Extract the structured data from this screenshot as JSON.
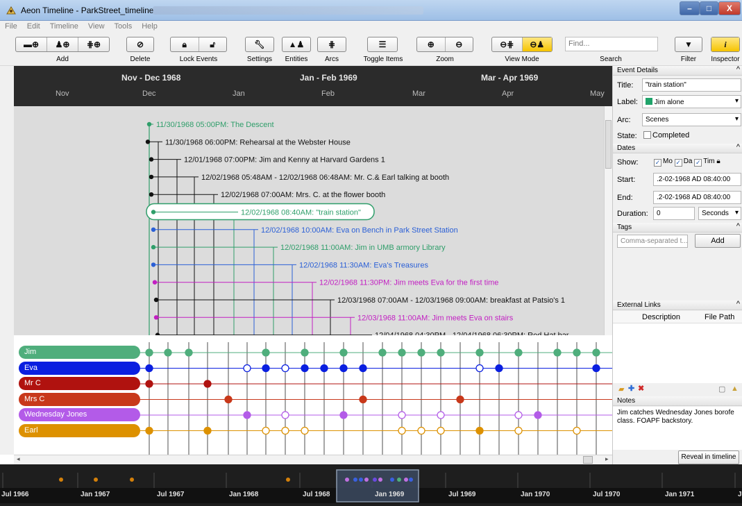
{
  "window": {
    "title": "Aeon Timeline - ParkStreet_timeline",
    "min": "–",
    "max": "□",
    "close": "X"
  },
  "menu": [
    "File",
    "Edit",
    "Timeline",
    "View",
    "Tools",
    "Help"
  ],
  "toolbar": {
    "add_label": "Add",
    "delete_label": "Delete",
    "lock_label": "Lock Events",
    "settings_label": "Settings",
    "entities_label": "Entities",
    "arcs_label": "Arcs",
    "toggle_label": "Toggle Items",
    "zoom_label": "Zoom",
    "viewmode_label": "View Mode",
    "search_placeholder": "Find...",
    "search_label": "Search",
    "filter_label": "Filter",
    "inspector_label": "Inspector"
  },
  "header": {
    "periods": [
      "Nov - Dec 1968",
      "Jan - Feb 1969",
      "Mar - Apr 1969"
    ],
    "months": [
      "Nov",
      "Dec",
      "Jan",
      "Feb",
      "Mar",
      "Apr",
      "May"
    ]
  },
  "events": [
    {
      "text": "11/30/1968 05:00PM: The Descent",
      "color": "#2f9e6a"
    },
    {
      "text": "11/30/1968 06:00PM: Rehearsal at the Webster House",
      "color": "#111111"
    },
    {
      "text": "12/01/1968 07:00PM: Jim and Kenny at Harvard Gardens 1",
      "color": "#111111"
    },
    {
      "text": "12/02/1968 05:48AM - 12/02/1968 06:48AM: Mr. C.& Earl talking at booth",
      "color": "#111111"
    },
    {
      "text": "12/02/1968 07:00AM: Mrs. C. at the flower booth",
      "color": "#111111"
    },
    {
      "text": "12/02/1968 08:40AM: \"train station\"",
      "color": "#2f9e6a",
      "selected": true
    },
    {
      "text": "12/02/1968 10:00AM: Eva on Bench in Park Street Station",
      "color": "#2a5fd6"
    },
    {
      "text": "12/02/1968 11:00AM: Jim in UMB armory Library",
      "color": "#2f9e6a"
    },
    {
      "text": "12/02/1968 11:30AM: Eva's Treasures",
      "color": "#2a5fd6"
    },
    {
      "text": "12/02/1968 11:30PM: Jim meets Eva for the first time",
      "color": "#c21fc2"
    },
    {
      "text": "12/03/1968 07:00AM - 12/03/1968 09:00AM: breakfast at Patsio's 1",
      "color": "#111111"
    },
    {
      "text": "12/03/1968 11:00AM: Jim meets Eva on stairs",
      "color": "#c21fc2"
    },
    {
      "text": "12/04/1968 04:30PM - 12/04/1968 06:30PM: Red Hat bar",
      "color": "#111111"
    }
  ],
  "entities": [
    {
      "name": "Jim",
      "color": "#4fae7c"
    },
    {
      "name": "Eva",
      "color": "#0a1fe0"
    },
    {
      "name": "Mr C",
      "color": "#b0120f"
    },
    {
      "name": "Mrs C",
      "color": "#c8381a"
    },
    {
      "name": "Wednesday Jones",
      "color": "#b35be8"
    },
    {
      "name": "Earl",
      "color": "#dd9100"
    }
  ],
  "overview": {
    "labels": [
      "Jul 1966",
      "Jan 1967",
      "Jul 1967",
      "Jan 1968",
      "Jul 1968",
      "Jan 1969",
      "Jul 1969",
      "Jan 1970",
      "Jul 1970",
      "Jan 1971",
      "Jul"
    ]
  },
  "inspector": {
    "event_details": "Event Details",
    "title_label": "Title:",
    "title_value": "\"train station\"",
    "label_label": "Label:",
    "label_value": "Jim alone",
    "label_color": "#1fa36a",
    "arc_label": "Arc:",
    "arc_value": "Scenes",
    "state_label": "State:",
    "state_value": "Completed",
    "dates": "Dates",
    "show_label": "Show:",
    "show_mo": "Mo",
    "show_da": "Da",
    "show_tim": "Tim",
    "start_label": "Start:",
    "start_value": ".2-02-1968 AD 08:40:00",
    "end_label": "End:",
    "end_value": ".2-02-1968 AD 08:40:00",
    "duration_label": "Duration:",
    "duration_value": "0",
    "duration_unit": "Seconds",
    "tags": "Tags",
    "tags_placeholder": "Comma-separated t...",
    "tags_add": "Add",
    "external_links": "External Links",
    "col_description": "Description",
    "col_filepath": "File Path",
    "notes": "Notes",
    "notes_text": "Jim catches Wednesday Jones borofe class. FOAPF backstory.",
    "reveal": "Reveal in timeline"
  }
}
